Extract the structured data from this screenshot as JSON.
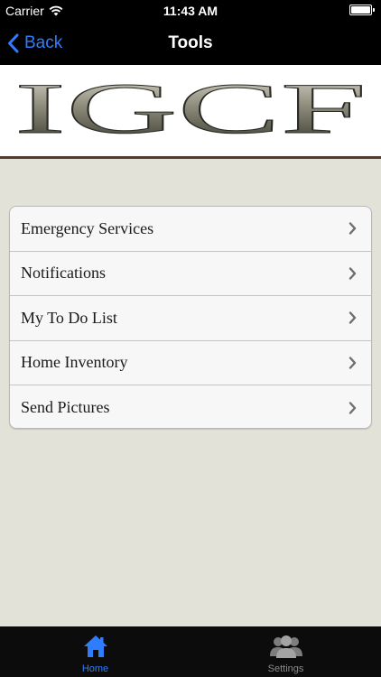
{
  "status_bar": {
    "carrier": "Carrier",
    "time": "11:43 AM"
  },
  "nav": {
    "back_label": "Back",
    "title": "Tools"
  },
  "banner": {
    "logo_text": "IGCF"
  },
  "menu": {
    "items": [
      {
        "label": "Emergency Services"
      },
      {
        "label": "Notifications"
      },
      {
        "label": "My To Do List"
      },
      {
        "label": "Home Inventory"
      },
      {
        "label": "Send Pictures"
      }
    ]
  },
  "tab_bar": {
    "tabs": [
      {
        "label": "Home",
        "icon": "home-icon",
        "active": true
      },
      {
        "label": "Settings",
        "icon": "users-icon",
        "active": false
      }
    ]
  },
  "colors": {
    "accent": "#2f7dff",
    "background": "#e3e2d9",
    "banner_rule": "#5a3a24"
  }
}
